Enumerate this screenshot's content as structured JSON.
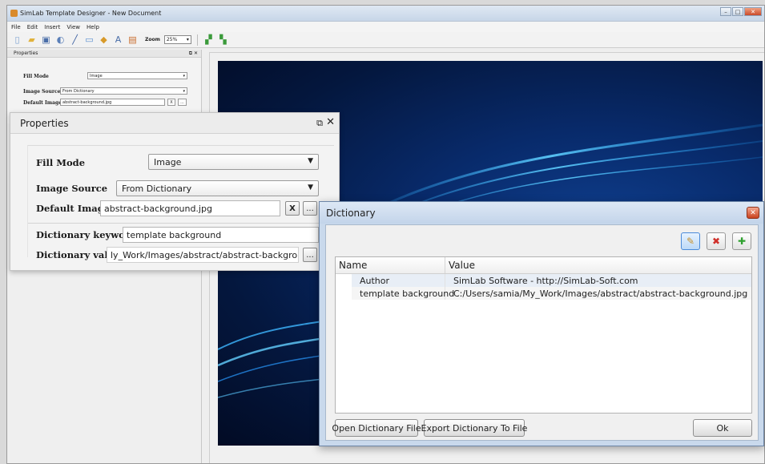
{
  "app": {
    "title": "SimLab Template Designer - New Document",
    "menu": [
      "File",
      "Edit",
      "Insert",
      "View",
      "Help"
    ],
    "zoom_label": "Zoom",
    "zoom_value": "25%"
  },
  "small_properties": {
    "title": "Properties",
    "fill_mode_label": "Fill Mode",
    "fill_mode_value": "Image",
    "image_source_label": "Image Source",
    "image_source_value": "From Dictionary",
    "default_image_label": "Default Image",
    "default_image_value": "abstract-background.jpg",
    "clear_label": "X",
    "browse_label": "..."
  },
  "properties": {
    "title": "Properties",
    "fill_mode_label": "Fill Mode",
    "fill_mode_value": "Image",
    "image_source_label": "Image Source",
    "image_source_value": "From Dictionary",
    "default_image_label": "Default Image",
    "default_image_value": "abstract-background.jpg",
    "clear_label": "X",
    "browse_label": "...",
    "dict_keyword_label": "Dictionary keyword",
    "dict_keyword_value": "template background",
    "dict_value_label": "Dictionary value",
    "dict_value_value": "ly_Work/Images/abstract/abstract-background.jpg",
    "dict_value_browse": "..."
  },
  "dictionary": {
    "title": "Dictionary",
    "columns": {
      "name": "Name",
      "value": "Value"
    },
    "rows": [
      {
        "name": "Author",
        "value": "SimLab Software - http://SimLab-Soft.com"
      },
      {
        "name": "template background",
        "value": "C:/Users/samia/My_Work/Images/abstract/abstract-background.jpg"
      }
    ],
    "open_button": "Open Dictionary File",
    "export_button": "Export Dictionary To File",
    "ok_button": "Ok"
  }
}
